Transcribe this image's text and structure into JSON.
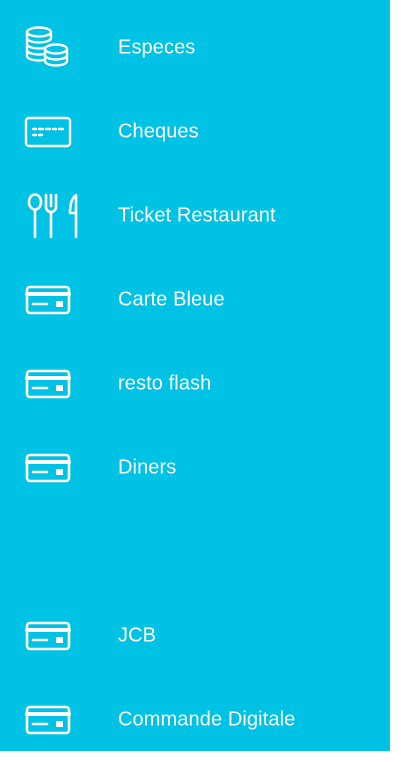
{
  "panel": {
    "background_color": "#00c2e4",
    "text_color": "#ffffff"
  },
  "payment_methods": [
    {
      "label": "Especes",
      "icon": "coins-icon"
    },
    {
      "label": "Cheques",
      "icon": "cheque-icon"
    },
    {
      "label": "Ticket Restaurant",
      "icon": "cutlery-icon"
    },
    {
      "label": "Carte Bleue",
      "icon": "credit-card-icon"
    },
    {
      "label": "resto flash",
      "icon": "credit-card-icon"
    },
    {
      "label": "Diners",
      "icon": "credit-card-icon"
    },
    {
      "label": "JCB",
      "icon": "credit-card-icon"
    },
    {
      "label": "Commande Digitale",
      "icon": "credit-card-icon"
    }
  ]
}
